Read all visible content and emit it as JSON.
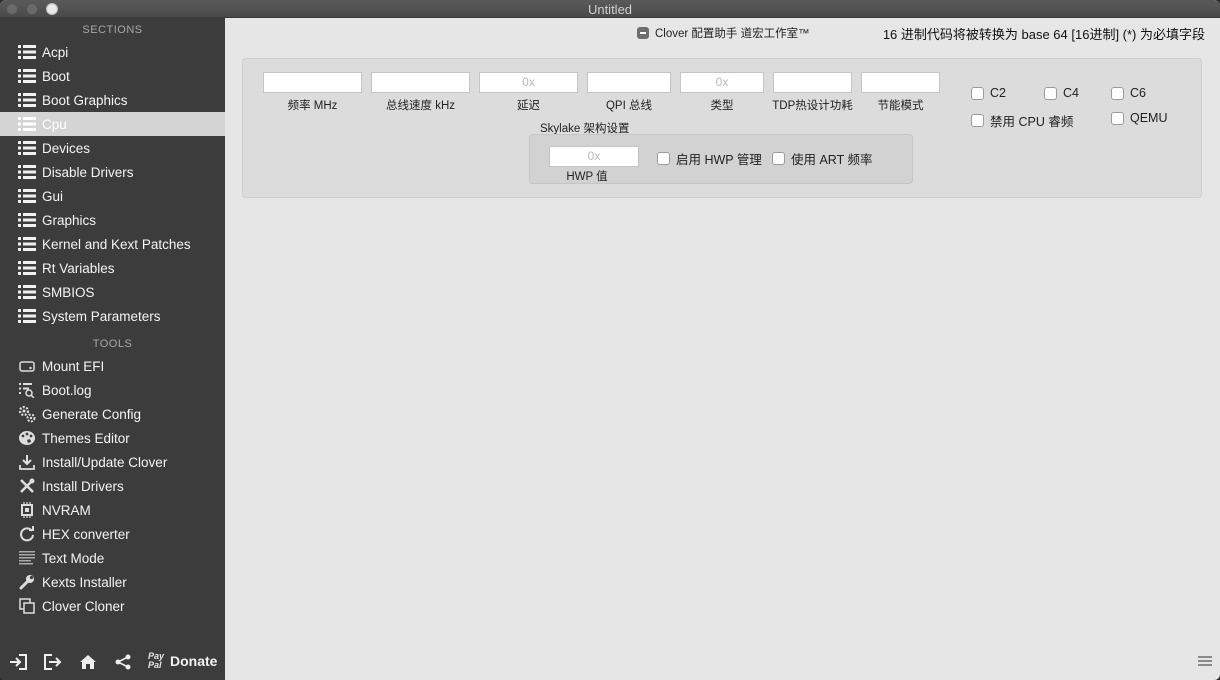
{
  "window": {
    "title": "Untitled"
  },
  "sidebar": {
    "sections_header": "SECTIONS",
    "tools_header": "TOOLS",
    "sections": [
      {
        "label": "Acpi",
        "icon": "list-icon"
      },
      {
        "label": "Boot",
        "icon": "list-icon"
      },
      {
        "label": "Boot Graphics",
        "icon": "list-icon"
      },
      {
        "label": "Cpu",
        "icon": "list-icon",
        "selected": true
      },
      {
        "label": "Devices",
        "icon": "list-icon"
      },
      {
        "label": "Disable Drivers",
        "icon": "list-icon"
      },
      {
        "label": "Gui",
        "icon": "list-icon"
      },
      {
        "label": "Graphics",
        "icon": "list-icon"
      },
      {
        "label": "Kernel and Kext Patches",
        "icon": "list-icon"
      },
      {
        "label": "Rt Variables",
        "icon": "list-icon"
      },
      {
        "label": "SMBIOS",
        "icon": "list-icon"
      },
      {
        "label": "System Parameters",
        "icon": "list-icon"
      }
    ],
    "tools": [
      {
        "label": "Mount EFI",
        "icon": "disk-icon"
      },
      {
        "label": "Boot.log",
        "icon": "log-search-icon"
      },
      {
        "label": "Generate Config",
        "icon": "gears-icon"
      },
      {
        "label": "Themes Editor",
        "icon": "palette-icon"
      },
      {
        "label": "Install/Update Clover",
        "icon": "download-icon"
      },
      {
        "label": "Install Drivers",
        "icon": "tools-icon"
      },
      {
        "label": "NVRAM",
        "icon": "chip-icon"
      },
      {
        "label": "HEX converter",
        "icon": "refresh-icon"
      },
      {
        "label": "Text Mode",
        "icon": "text-lines-icon"
      },
      {
        "label": "Kexts Installer",
        "icon": "wrench-icon"
      },
      {
        "label": "Clover Cloner",
        "icon": "copy-icon"
      }
    ],
    "bottom": {
      "paypal_text": "Pay\nPal",
      "donate_label": "Donate",
      "buttons": [
        "import-icon",
        "export-icon",
        "home-icon",
        "share-icon"
      ]
    }
  },
  "main": {
    "header_checkbox_label": "Clover 配置助手 道宏工作室™",
    "header_info": "16 进制代码将被转换为 base 64 [16进制]   (*) 为必填字段",
    "fields": [
      {
        "label": "频率 MHz",
        "placeholder": ""
      },
      {
        "label": "总线速度 kHz",
        "placeholder": ""
      },
      {
        "label": "延迟",
        "placeholder": "0x"
      },
      {
        "label": "QPI 总线",
        "placeholder": ""
      },
      {
        "label": "类型",
        "placeholder": "0x"
      },
      {
        "label": "TDP热设计功耗",
        "placeholder": ""
      },
      {
        "label": "节能模式",
        "placeholder": ""
      }
    ],
    "checkboxes": [
      {
        "label": "C2"
      },
      {
        "label": "C4"
      },
      {
        "label": "C6"
      },
      {
        "label": "禁用 CPU 睿频"
      },
      {
        "label": "QEMU"
      }
    ],
    "skylake": {
      "title": "Skylake 架构设置",
      "hwp_placeholder": "0x",
      "hwp_label": "HWP 值",
      "enable_hwp": "启用 HWP 管理",
      "use_art": "使用 ART 频率"
    }
  }
}
